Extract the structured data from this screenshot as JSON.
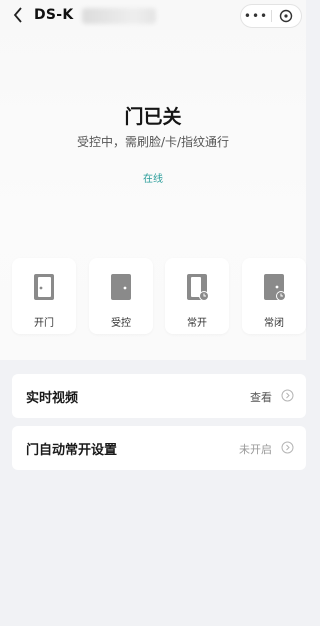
{
  "nav": {
    "title": "DS-K"
  },
  "status": {
    "door_state": "门已关",
    "description": "受控中，需刷脸/卡/指纹通行",
    "connection": "在线"
  },
  "actions": [
    {
      "label": "开门",
      "icon": "door-open-icon"
    },
    {
      "label": "受控",
      "icon": "door-controlled-icon"
    },
    {
      "label": "常开",
      "icon": "door-always-open-icon"
    },
    {
      "label": "常闭",
      "icon": "door-always-closed-icon"
    }
  ],
  "settings": {
    "live_video": {
      "label": "实时视频",
      "value": "查看"
    },
    "auto_open": {
      "label": "门自动常开设置",
      "value": "未开启"
    }
  },
  "colors": {
    "accent": "#2a9d9a",
    "background": "#f1f2f5",
    "icon_gray": "#8a8a8a"
  }
}
